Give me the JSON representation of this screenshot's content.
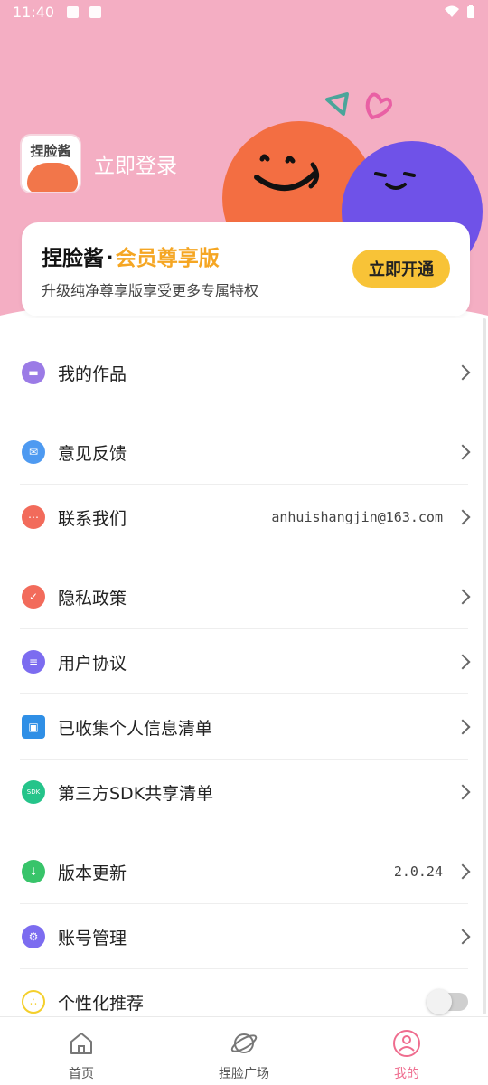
{
  "status_bar": {
    "time": "11:40"
  },
  "header": {
    "logo_text": "捏脸酱",
    "login_label": "立即登录"
  },
  "vip_card": {
    "brand": "捏脸酱",
    "separator": "·",
    "edition": "会员尊享版",
    "subtitle": "升级纯净尊享版享受更多专属特权",
    "button": "立即开通"
  },
  "menu": {
    "works": {
      "label": "我的作品",
      "icon": "folder-icon",
      "color": "#9b7be6"
    },
    "feedback": {
      "label": "意见反馈",
      "icon": "mail-icon",
      "color": "#4e9af1"
    },
    "contact": {
      "label": "联系我们",
      "value": "anhuishangjin@163.com",
      "icon": "chat-icon",
      "color": "#f26b5b"
    },
    "privacy": {
      "label": "隐私政策",
      "icon": "shield-icon",
      "color": "#f26b5b"
    },
    "agreement": {
      "label": "用户协议",
      "icon": "document-icon",
      "color": "#7c6cf0"
    },
    "personal_info": {
      "label": "已收集个人信息清单",
      "icon": "id-card-icon",
      "color": "#2f8fe6"
    },
    "sdk": {
      "label": "第三方SDK共享清单",
      "icon": "sdk-icon",
      "color": "#25c48a"
    },
    "update": {
      "label": "版本更新",
      "value": "2.0.24",
      "icon": "download-icon",
      "color": "#38c46a"
    },
    "account": {
      "label": "账号管理",
      "icon": "gear-icon",
      "color": "#7c6cf0"
    },
    "personalized": {
      "label": "个性化推荐",
      "icon": "dots-icon",
      "color": "#f4cf2c",
      "enabled": false
    }
  },
  "tabs": [
    {
      "label": "首页",
      "icon": "home-icon"
    },
    {
      "label": "捏脸广场",
      "icon": "planet-icon"
    },
    {
      "label": "我的",
      "icon": "profile-icon",
      "active": true
    }
  ]
}
